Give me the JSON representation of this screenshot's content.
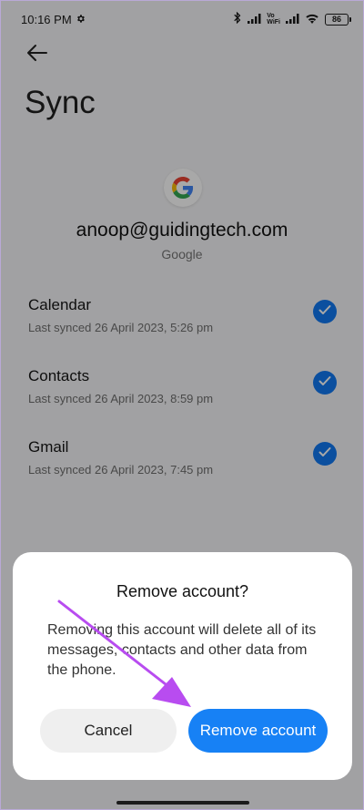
{
  "status_bar": {
    "time": "10:16 PM",
    "vowifi_top": "Vo",
    "vowifi_bottom": "WiFi",
    "battery": "86"
  },
  "header": {
    "back_icon": "arrow-left-icon",
    "title": "Sync"
  },
  "account": {
    "logo_icon": "google-g-logo",
    "email": "anoop@guidingtech.com",
    "type": "Google"
  },
  "sync_items": [
    {
      "name": "Calendar",
      "last_synced": "Last synced 26 April 2023, 5:26 pm",
      "checked": true
    },
    {
      "name": "Contacts",
      "last_synced": "Last synced 26 April 2023, 8:59 pm",
      "checked": true
    },
    {
      "name": "Gmail",
      "last_synced": "Last synced 26 April 2023, 7:45 pm",
      "checked": true
    }
  ],
  "dialog": {
    "title": "Remove account?",
    "message": "Removing this account will delete all of its messages, contacts and other data from the phone.",
    "cancel_label": "Cancel",
    "remove_label": "Remove account"
  },
  "colors": {
    "accent": "#1781f5",
    "check": "#1278f2",
    "annotation_arrow": "#b84cf0"
  }
}
